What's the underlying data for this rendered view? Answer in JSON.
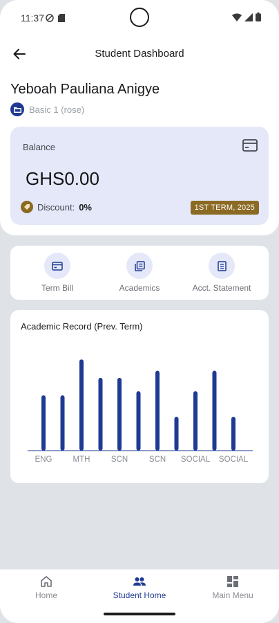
{
  "status_bar": {
    "time": "11:37"
  },
  "header": {
    "title": "Student Dashboard"
  },
  "student": {
    "name": "Yeboah Pauliana Anigye",
    "class_label": "Basic 1 (rose)"
  },
  "balance": {
    "label": "Balance",
    "amount": "GHS0.00",
    "discount_label": "Discount:",
    "discount_value": "0%",
    "term": "1ST TERM, 2025"
  },
  "quick_actions": [
    {
      "label": "Term Bill",
      "icon": "bill-icon"
    },
    {
      "label": "Academics",
      "icon": "academics-icon"
    },
    {
      "label": "Acct. Statement",
      "icon": "statement-icon"
    }
  ],
  "chart_data": {
    "type": "bar",
    "title": "Academic Record (Prev. Term)",
    "categories": [
      "ENG",
      "",
      "MTH",
      "",
      "SCN",
      "",
      "SCN",
      "",
      "SOCIAL",
      "",
      "SOCIAL"
    ],
    "values": [
      54,
      54,
      89,
      71,
      71,
      58,
      78,
      33,
      58,
      78,
      33
    ],
    "ylim": [
      0,
      100
    ],
    "bar_color": "#1f3a93",
    "grid": false
  },
  "bottom_nav": [
    {
      "label": "Home",
      "icon": "home-icon",
      "active": false
    },
    {
      "label": "Student Home",
      "icon": "people-icon",
      "active": true
    },
    {
      "label": "Main Menu",
      "icon": "grid-icon",
      "active": false
    }
  ],
  "colors": {
    "accent": "#1f3a93",
    "gold": "#8b6a23",
    "card_bg": "#e4e8f8"
  }
}
